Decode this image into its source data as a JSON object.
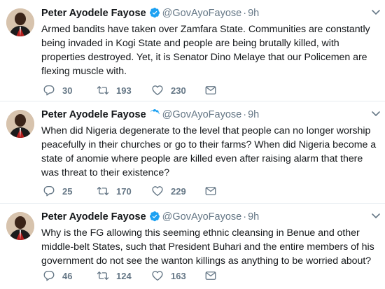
{
  "tweets": [
    {
      "name": "Peter Ayodele Fayose",
      "handle": "@GovAyoFayose",
      "separator": "·",
      "time": "9h",
      "text": "Armed bandits have taken over Zamfara State. Communities are constantly being invaded in Kogi State and people are being brutally killed, with properties destroyed. Yet,  it is Senator Dino Melaye that our Policemen are flexing muscle with.",
      "replies": "30",
      "retweets": "193",
      "likes": "230"
    },
    {
      "name": "Peter Ayodele Fayose",
      "handle": "@GovAyoFayose",
      "separator": "·",
      "time": "9h",
      "text": "When did Nigeria degenerate to the level that people can no longer worship peacefully in their churches or go to their farms? When did Nigeria become a state of anomie where people are killed even after raising alarm that there was threat to their existence?",
      "replies": "25",
      "retweets": "170",
      "likes": "229"
    },
    {
      "name": "Peter Ayodele Fayose",
      "handle": "@GovAyoFayose",
      "separator": "·",
      "time": "9h",
      "text": "Why is the FG allowing this seeming ethnic cleansing in Benue and other middle-belt States, such that President Buhari and the entire members of his government do not see the wanton killings as anything to be worried about?",
      "replies": "46",
      "retweets": "124",
      "likes": "163"
    }
  ],
  "icons": {
    "verified": "verified-badge-icon",
    "reply": "reply-icon",
    "retweet": "retweet-icon",
    "like": "heart-icon",
    "dm": "envelope-icon",
    "caret": "chevron-down-icon"
  },
  "colors": {
    "verified": "#1da1f2",
    "muted": "#657786",
    "text": "#14171a",
    "border": "#e6ecf0"
  }
}
